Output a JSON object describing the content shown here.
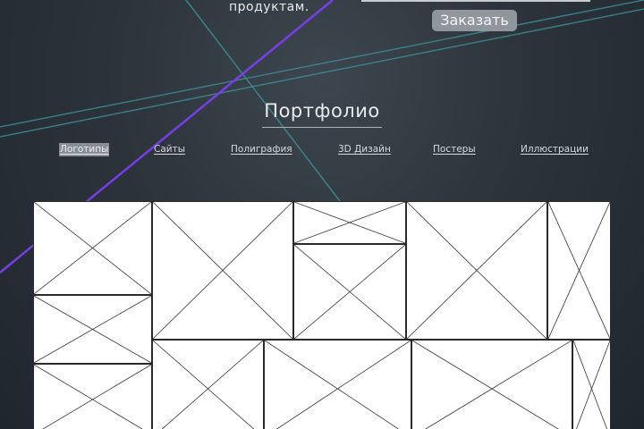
{
  "hero": {
    "text": "продуктам.",
    "order_button": "Заказать"
  },
  "portfolio": {
    "title": "Портфолио",
    "tabs": [
      {
        "label": "Логотипы",
        "active": true
      },
      {
        "label": "Сайты",
        "active": false
      },
      {
        "label": "Полиграфия",
        "active": false
      },
      {
        "label": "3D Дизайн",
        "active": false
      },
      {
        "label": "Постеры",
        "active": false
      },
      {
        "label": "Иллюстрации",
        "active": false
      }
    ]
  },
  "colors": {
    "accent_purple": "#7b3ff2",
    "accent_teal": "#3d8f97",
    "button_bg": "#8f969c"
  },
  "icons": {
    "placeholder": "image-placeholder-icon"
  }
}
